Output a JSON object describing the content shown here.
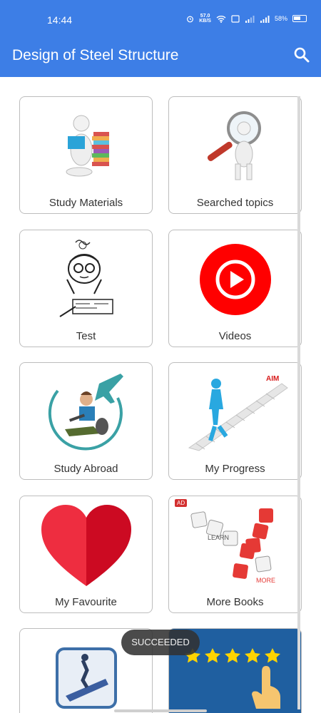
{
  "status_bar": {
    "time": "14:44",
    "speed_value": "57.0",
    "speed_unit": "KB/S",
    "battery": "58%"
  },
  "app_bar": {
    "title": "Design of Steel Structure",
    "search_icon": "search-icon"
  },
  "menu": {
    "items": [
      {
        "label": "Study Materials",
        "icon": "reading-person-icon"
      },
      {
        "label": "Searched topics",
        "icon": "magnifying-glass-person-icon"
      },
      {
        "label": "Test",
        "icon": "stressed-student-icon"
      },
      {
        "label": "Videos",
        "icon": "play-button-icon"
      },
      {
        "label": "Study Abroad",
        "icon": "airplane-student-icon"
      },
      {
        "label": "My Progress",
        "icon": "stairs-aim-icon"
      },
      {
        "label": "My Favourite",
        "icon": "heart-icon"
      },
      {
        "label": "More Books",
        "icon": "learn-more-dice-icon",
        "badge": "AD"
      },
      {
        "label": "",
        "icon": "app-logo-icon"
      },
      {
        "label": "",
        "icon": "rating-stars-icon"
      }
    ],
    "learn_word": "LEARN",
    "more_word": "MORE",
    "aim_word": "AIM"
  },
  "toast": "SUCCEEDED",
  "colors": {
    "primary": "#3d7ee6",
    "youtube_red": "#ff0000",
    "heart_red": "#e8283a",
    "progress_blue": "#29a8e0"
  }
}
